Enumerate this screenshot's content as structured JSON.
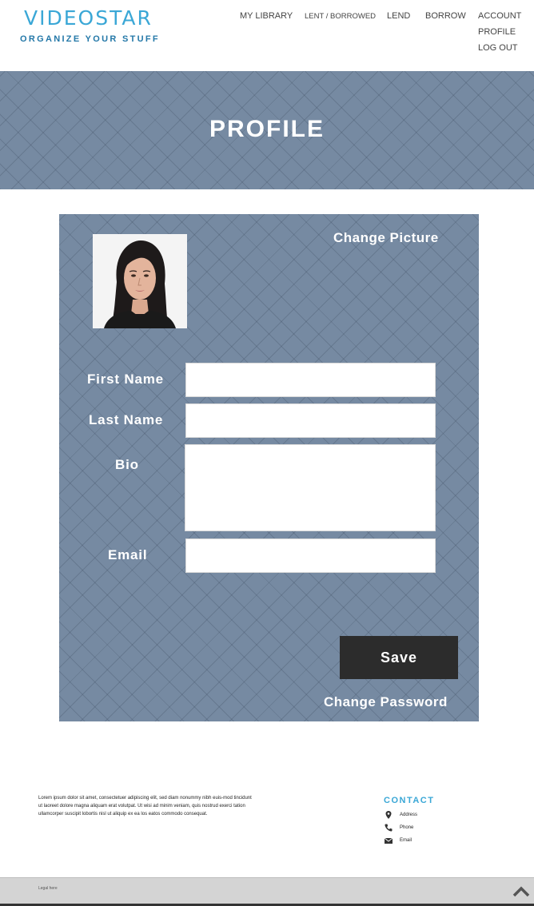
{
  "header": {
    "logo": "VIDEOSTAR",
    "tagline": "ORGANIZE YOUR STUFF",
    "nav": {
      "my_library": "MY LIBRARY",
      "lent_borrowed": "LENT / BORROWED",
      "lend": "LEND",
      "borrow": "BORROW",
      "account": "ACCOUNT",
      "profile": "PROFILE",
      "logout": "LOG OUT"
    }
  },
  "banner": {
    "title": "PROFILE"
  },
  "profile_card": {
    "change_picture": "Change Picture",
    "avatar_icon": "person-avatar-icon",
    "fields": {
      "first_name": {
        "label": "First Name",
        "value": ""
      },
      "last_name": {
        "label": "Last Name",
        "value": ""
      },
      "bio": {
        "label": "Bio",
        "value": ""
      },
      "email": {
        "label": "Email",
        "value": ""
      }
    },
    "save_label": "Save",
    "change_password": "Change Password"
  },
  "footer": {
    "lorem": "Lorem ipsum dolor sit amet, consectetuer adipiscing elit, sed diam nonummy nibh euis-mod tincidunt ut laoreet dolore magna aliquam erat volutpat. Ut wisi ad minim veniam, quis nostrud exerci tation ullamcorper suscipit lobortis nisl ut aliquip ex ea los eatos commodo consequat.",
    "contact": {
      "title": "CONTACT",
      "address": "Address",
      "phone": "Phone",
      "email": "Email"
    },
    "legal": "Legal here"
  },
  "colors": {
    "accent": "#3aa7d6",
    "accent_dark": "#2478a8",
    "panel": "#768aa2",
    "button": "#2c2c2c"
  }
}
